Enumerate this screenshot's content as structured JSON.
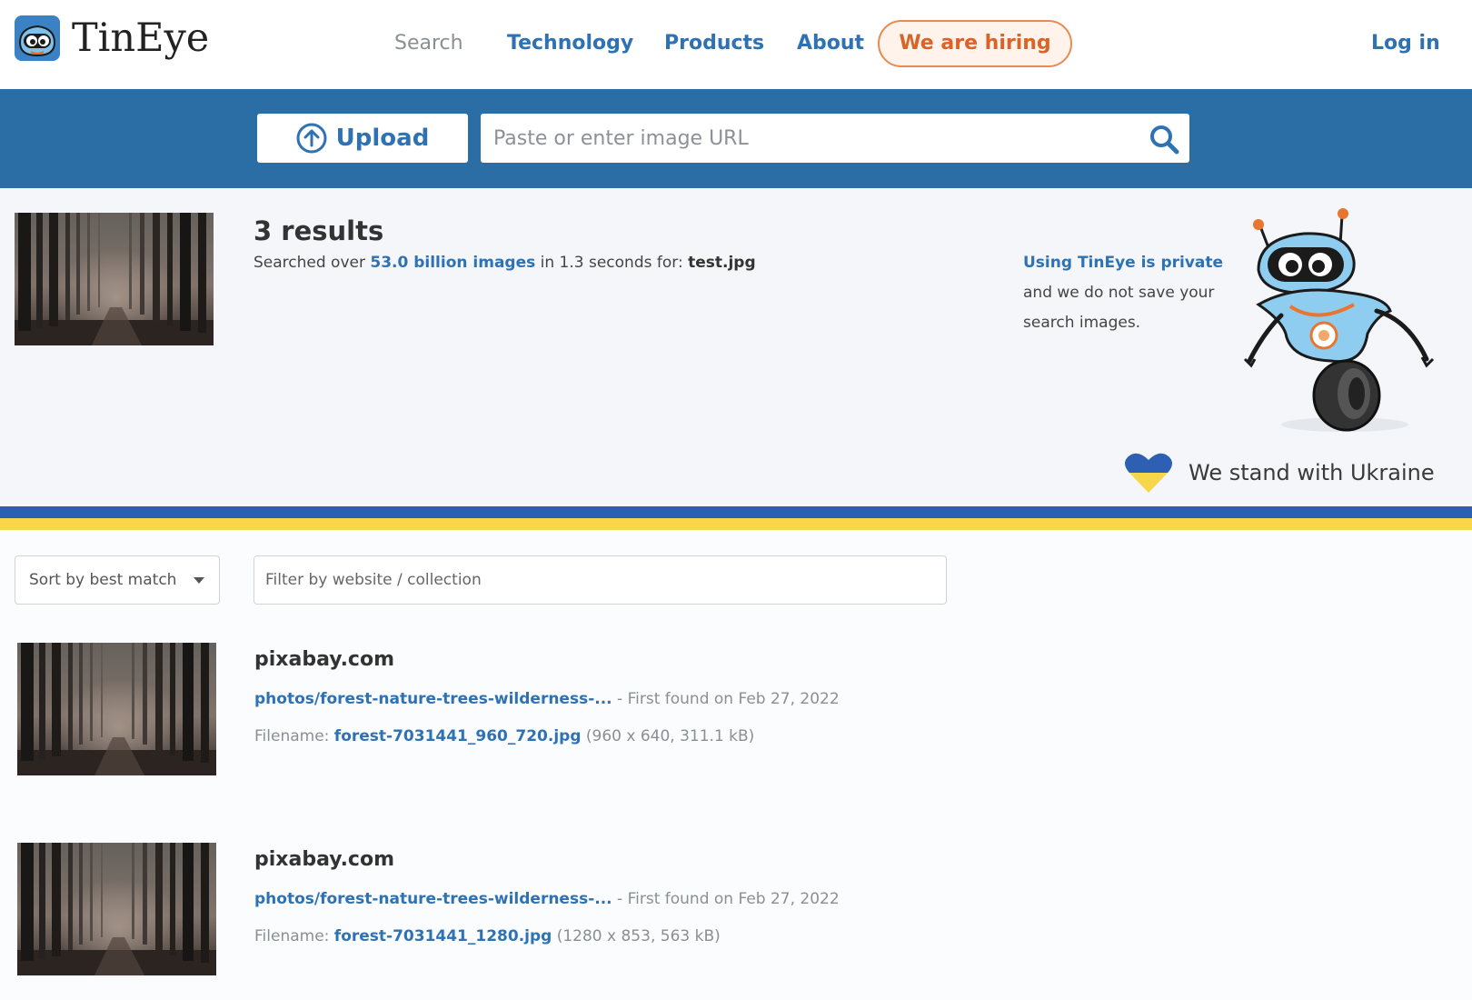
{
  "header": {
    "brand": "TinEye",
    "nav": {
      "search": "Search",
      "technology": "Technology",
      "products": "Products",
      "about": "About"
    },
    "hiring": "We are hiring",
    "login": "Log in"
  },
  "search": {
    "upload_label": "Upload",
    "url_placeholder": "Paste or enter image URL"
  },
  "summary": {
    "results_count": "3 results",
    "searched_prefix": "Searched over ",
    "searched_link": "53.0 billion images",
    "searched_mid": " in 1.3 seconds for: ",
    "searched_file": "test.jpg"
  },
  "privacy": {
    "link": "Using TinEye is private",
    "text": "and we do not save your search images."
  },
  "ukraine": "We stand with Ukraine",
  "filters": {
    "sort_selected": "Sort by best match",
    "filter_placeholder": "Filter by website / collection"
  },
  "results": [
    {
      "site": "pixabay.com",
      "page_link": "photos/forest-nature-trees-wilderness-...",
      "first_found": " - First found on Feb 27, 2022",
      "filename_label": "Filename: ",
      "filename": "forest-7031441_960_720.jpg",
      "file_info": " (960 x 640, 311.1 kB)"
    },
    {
      "site": "pixabay.com",
      "page_link": "photos/forest-nature-trees-wilderness-...",
      "first_found": " - First found on Feb 27, 2022",
      "filename_label": "Filename: ",
      "filename": "forest-7031441_1280.jpg",
      "file_info": " (1280 x 853, 563 kB)"
    }
  ],
  "colors": {
    "brand_blue": "#2f72b4",
    "band": "#2b6ea6",
    "hiring_orange": "#d8642a",
    "ukraine_blue": "#2d5fb3",
    "ukraine_yellow": "#f7d64a"
  }
}
